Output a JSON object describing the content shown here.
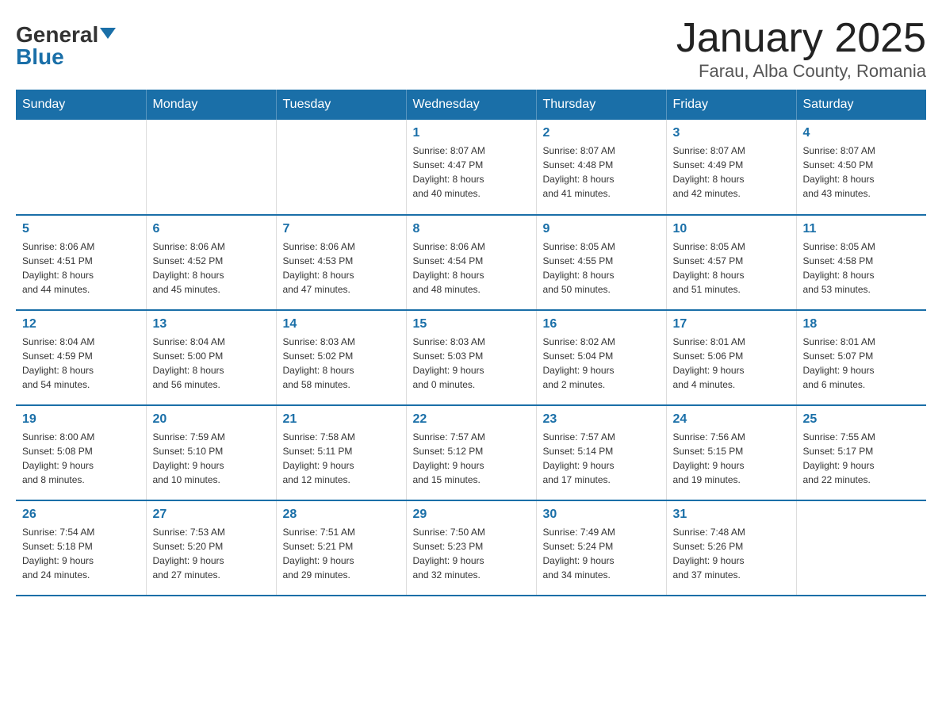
{
  "logo": {
    "general": "General",
    "blue": "Blue"
  },
  "title": "January 2025",
  "subtitle": "Farau, Alba County, Romania",
  "days_of_week": [
    "Sunday",
    "Monday",
    "Tuesday",
    "Wednesday",
    "Thursday",
    "Friday",
    "Saturday"
  ],
  "weeks": [
    [
      {
        "day": "",
        "info": ""
      },
      {
        "day": "",
        "info": ""
      },
      {
        "day": "",
        "info": ""
      },
      {
        "day": "1",
        "info": "Sunrise: 8:07 AM\nSunset: 4:47 PM\nDaylight: 8 hours\nand 40 minutes."
      },
      {
        "day": "2",
        "info": "Sunrise: 8:07 AM\nSunset: 4:48 PM\nDaylight: 8 hours\nand 41 minutes."
      },
      {
        "day": "3",
        "info": "Sunrise: 8:07 AM\nSunset: 4:49 PM\nDaylight: 8 hours\nand 42 minutes."
      },
      {
        "day": "4",
        "info": "Sunrise: 8:07 AM\nSunset: 4:50 PM\nDaylight: 8 hours\nand 43 minutes."
      }
    ],
    [
      {
        "day": "5",
        "info": "Sunrise: 8:06 AM\nSunset: 4:51 PM\nDaylight: 8 hours\nand 44 minutes."
      },
      {
        "day": "6",
        "info": "Sunrise: 8:06 AM\nSunset: 4:52 PM\nDaylight: 8 hours\nand 45 minutes."
      },
      {
        "day": "7",
        "info": "Sunrise: 8:06 AM\nSunset: 4:53 PM\nDaylight: 8 hours\nand 47 minutes."
      },
      {
        "day": "8",
        "info": "Sunrise: 8:06 AM\nSunset: 4:54 PM\nDaylight: 8 hours\nand 48 minutes."
      },
      {
        "day": "9",
        "info": "Sunrise: 8:05 AM\nSunset: 4:55 PM\nDaylight: 8 hours\nand 50 minutes."
      },
      {
        "day": "10",
        "info": "Sunrise: 8:05 AM\nSunset: 4:57 PM\nDaylight: 8 hours\nand 51 minutes."
      },
      {
        "day": "11",
        "info": "Sunrise: 8:05 AM\nSunset: 4:58 PM\nDaylight: 8 hours\nand 53 minutes."
      }
    ],
    [
      {
        "day": "12",
        "info": "Sunrise: 8:04 AM\nSunset: 4:59 PM\nDaylight: 8 hours\nand 54 minutes."
      },
      {
        "day": "13",
        "info": "Sunrise: 8:04 AM\nSunset: 5:00 PM\nDaylight: 8 hours\nand 56 minutes."
      },
      {
        "day": "14",
        "info": "Sunrise: 8:03 AM\nSunset: 5:02 PM\nDaylight: 8 hours\nand 58 minutes."
      },
      {
        "day": "15",
        "info": "Sunrise: 8:03 AM\nSunset: 5:03 PM\nDaylight: 9 hours\nand 0 minutes."
      },
      {
        "day": "16",
        "info": "Sunrise: 8:02 AM\nSunset: 5:04 PM\nDaylight: 9 hours\nand 2 minutes."
      },
      {
        "day": "17",
        "info": "Sunrise: 8:01 AM\nSunset: 5:06 PM\nDaylight: 9 hours\nand 4 minutes."
      },
      {
        "day": "18",
        "info": "Sunrise: 8:01 AM\nSunset: 5:07 PM\nDaylight: 9 hours\nand 6 minutes."
      }
    ],
    [
      {
        "day": "19",
        "info": "Sunrise: 8:00 AM\nSunset: 5:08 PM\nDaylight: 9 hours\nand 8 minutes."
      },
      {
        "day": "20",
        "info": "Sunrise: 7:59 AM\nSunset: 5:10 PM\nDaylight: 9 hours\nand 10 minutes."
      },
      {
        "day": "21",
        "info": "Sunrise: 7:58 AM\nSunset: 5:11 PM\nDaylight: 9 hours\nand 12 minutes."
      },
      {
        "day": "22",
        "info": "Sunrise: 7:57 AM\nSunset: 5:12 PM\nDaylight: 9 hours\nand 15 minutes."
      },
      {
        "day": "23",
        "info": "Sunrise: 7:57 AM\nSunset: 5:14 PM\nDaylight: 9 hours\nand 17 minutes."
      },
      {
        "day": "24",
        "info": "Sunrise: 7:56 AM\nSunset: 5:15 PM\nDaylight: 9 hours\nand 19 minutes."
      },
      {
        "day": "25",
        "info": "Sunrise: 7:55 AM\nSunset: 5:17 PM\nDaylight: 9 hours\nand 22 minutes."
      }
    ],
    [
      {
        "day": "26",
        "info": "Sunrise: 7:54 AM\nSunset: 5:18 PM\nDaylight: 9 hours\nand 24 minutes."
      },
      {
        "day": "27",
        "info": "Sunrise: 7:53 AM\nSunset: 5:20 PM\nDaylight: 9 hours\nand 27 minutes."
      },
      {
        "day": "28",
        "info": "Sunrise: 7:51 AM\nSunset: 5:21 PM\nDaylight: 9 hours\nand 29 minutes."
      },
      {
        "day": "29",
        "info": "Sunrise: 7:50 AM\nSunset: 5:23 PM\nDaylight: 9 hours\nand 32 minutes."
      },
      {
        "day": "30",
        "info": "Sunrise: 7:49 AM\nSunset: 5:24 PM\nDaylight: 9 hours\nand 34 minutes."
      },
      {
        "day": "31",
        "info": "Sunrise: 7:48 AM\nSunset: 5:26 PM\nDaylight: 9 hours\nand 37 minutes."
      },
      {
        "day": "",
        "info": ""
      }
    ]
  ]
}
